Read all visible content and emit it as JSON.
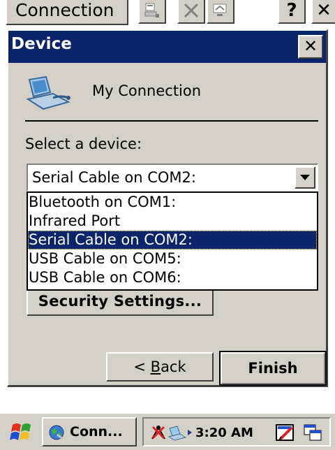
{
  "background_app": {
    "title_button": "Connection",
    "help_label": "?",
    "close_label": "✕"
  },
  "dialog": {
    "title": "Device",
    "close_label": "✕",
    "connection_name": "My Connection",
    "select_label": "Select a device:",
    "combo_value": "Serial Cable on COM2:",
    "devices": [
      "Bluetooth on COM1:",
      "Infrared Port",
      "Serial Cable on COM2:",
      "USB Cable on COM5:",
      "USB Cable on COM6:"
    ],
    "selected_index": 2,
    "security_button": "Security Settings...",
    "back_button_prefix": "< ",
    "back_button_access": "B",
    "back_button_rest": "ack",
    "finish_button": "Finish"
  },
  "taskbar": {
    "task_label": "Conn...",
    "clock": "3:20 AM"
  },
  "icons": {
    "connection": "computer-network-icon",
    "start": "windows-flag-icon",
    "tray_network": "network-disconnected-icon",
    "tray_sync": "activesync-icon",
    "tray_input": "input-panel-icon",
    "tray_desktop": "desktop-icon"
  },
  "colors": {
    "titlebar": "#0a246a",
    "selection": "#0a246a",
    "face": "#d4d0c8"
  }
}
